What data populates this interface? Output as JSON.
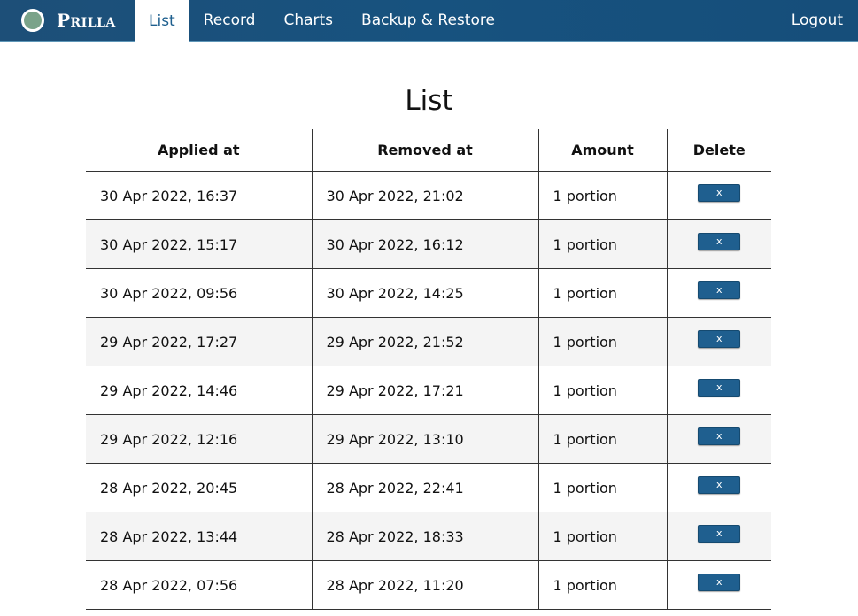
{
  "nav": {
    "brand": "Prilla",
    "items": [
      "List",
      "Record",
      "Charts",
      "Backup & Restore"
    ],
    "logout": "Logout"
  },
  "colors": {
    "navbar": "#17527f",
    "accent": "#1e5f8e",
    "logo_fill": "#7aa38a",
    "row_alt": "#f4f4f4"
  },
  "page": {
    "title": "List"
  },
  "table": {
    "headers": [
      "Applied at",
      "Removed at",
      "Amount",
      "Delete"
    ],
    "delete_label": "x",
    "rows": [
      {
        "applied": "30 Apr 2022, 16:37",
        "removed": "30 Apr 2022, 21:02",
        "amount": "1 portion"
      },
      {
        "applied": "30 Apr 2022, 15:17",
        "removed": "30 Apr 2022, 16:12",
        "amount": "1 portion"
      },
      {
        "applied": "30 Apr 2022, 09:56",
        "removed": "30 Apr 2022, 14:25",
        "amount": "1 portion"
      },
      {
        "applied": "29 Apr 2022, 17:27",
        "removed": "29 Apr 2022, 21:52",
        "amount": "1 portion"
      },
      {
        "applied": "29 Apr 2022, 14:46",
        "removed": "29 Apr 2022, 17:21",
        "amount": "1 portion"
      },
      {
        "applied": "29 Apr 2022, 12:16",
        "removed": "29 Apr 2022, 13:10",
        "amount": "1 portion"
      },
      {
        "applied": "28 Apr 2022, 20:45",
        "removed": "28 Apr 2022, 22:41",
        "amount": "1 portion"
      },
      {
        "applied": "28 Apr 2022, 13:44",
        "removed": "28 Apr 2022, 18:33",
        "amount": "1 portion"
      },
      {
        "applied": "28 Apr 2022, 07:56",
        "removed": "28 Apr 2022, 11:20",
        "amount": "1 portion"
      }
    ]
  }
}
